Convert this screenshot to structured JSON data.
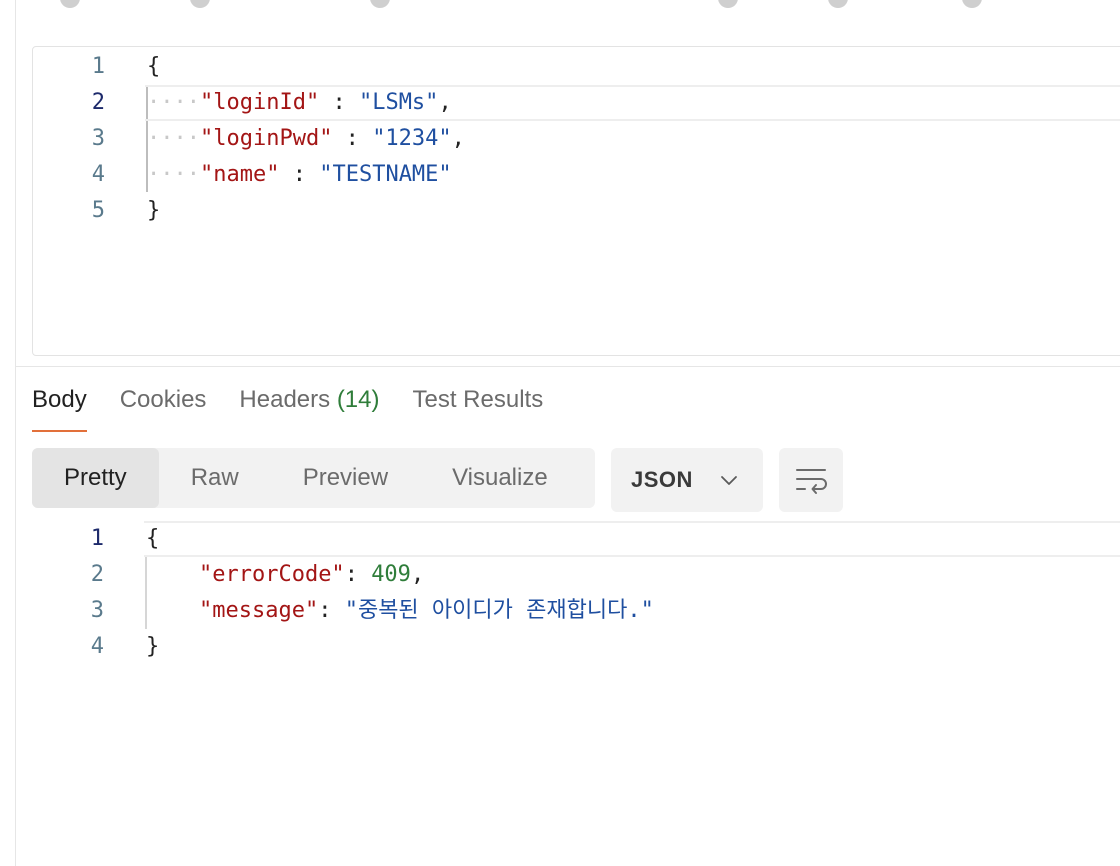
{
  "request_body": {
    "line_numbers": [
      "1",
      "2",
      "3",
      "4",
      "5"
    ],
    "lines": {
      "l1": "{",
      "l2_key": "\"loginId\"",
      "l2_sep": " : ",
      "l2_val": "\"LSMs\"",
      "l2_end": ",",
      "l3_key": "\"loginPwd\"",
      "l3_sep": " : ",
      "l3_val": "\"1234\"",
      "l3_end": ",",
      "l4_key": "\"name\"",
      "l4_sep": " : ",
      "l4_val": "\"TESTNAME\"",
      "l5": "}"
    }
  },
  "response_tabs": {
    "body": "Body",
    "cookies": "Cookies",
    "headers": "Headers",
    "headers_count": "(14)",
    "test_results": "Test Results"
  },
  "view_modes": {
    "pretty": "Pretty",
    "raw": "Raw",
    "preview": "Preview",
    "visualize": "Visualize",
    "selected": "Pretty"
  },
  "format": {
    "selected": "JSON"
  },
  "response_body": {
    "line_numbers": [
      "1",
      "2",
      "3",
      "4"
    ],
    "lines": {
      "l1": "{",
      "l2_key": "\"errorCode\"",
      "l2_colon": ": ",
      "l2_val": "409",
      "l2_end": ",",
      "l3_key": "\"message\"",
      "l3_colon": ": ",
      "l3_val": "\"중복된 아이디가 존재합니다.\"",
      "l4": "}"
    }
  },
  "colors": {
    "key": "#a31515",
    "string": "#1f4fa0",
    "number": "#2f7d3a",
    "active_tab_underline": "#e2703a"
  },
  "icons": {
    "format_dropdown": "chevron-down-icon",
    "wrap_lines": "wrap-lines-icon"
  }
}
